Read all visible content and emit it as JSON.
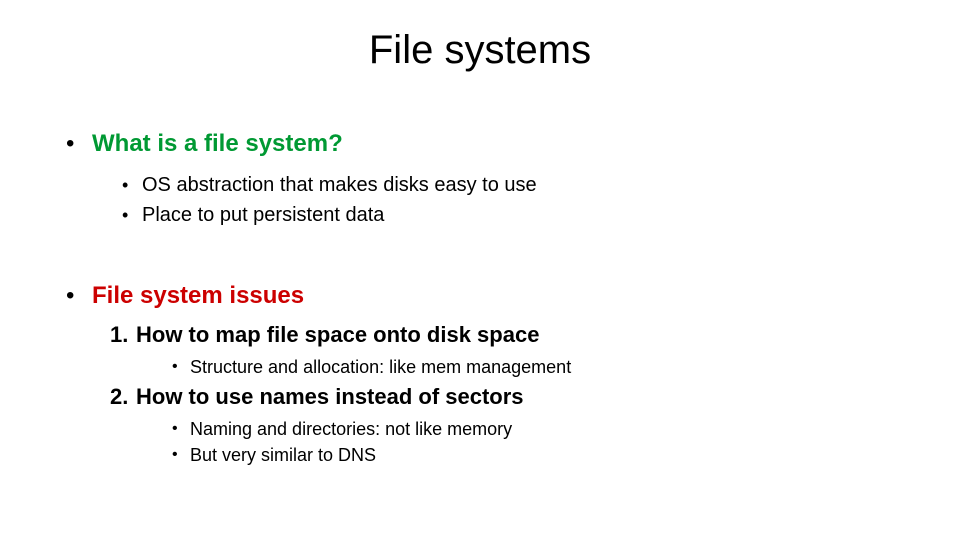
{
  "title": "File systems",
  "section1": {
    "heading": "What is a file system?",
    "bullets": [
      "OS abstraction that makes disks easy to use",
      "Place to put persistent data"
    ]
  },
  "section2": {
    "heading": "File system issues",
    "items": [
      {
        "label": "How to map file space onto disk space",
        "sub": [
          "Structure and allocation: like mem management"
        ]
      },
      {
        "label": "How to use names instead of sectors",
        "sub": [
          "Naming and directories: not like memory",
          "But very similar to DNS"
        ]
      }
    ]
  }
}
